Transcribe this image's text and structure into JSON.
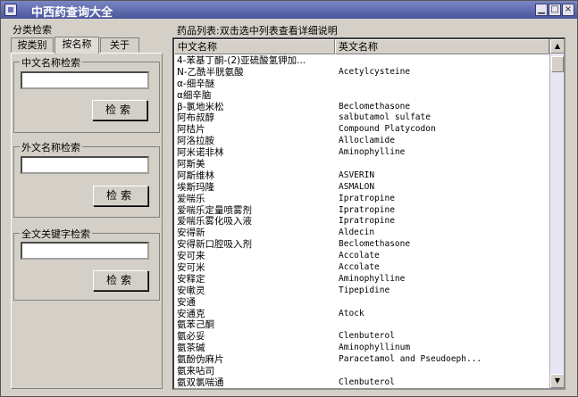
{
  "window": {
    "title": "中西药查询大全"
  },
  "left_panel": {
    "header": "分类检索",
    "tabs": [
      "按类别",
      "按名称",
      "关于"
    ],
    "groups": [
      {
        "label": "中文名称检索",
        "input_value": "",
        "button": "检索"
      },
      {
        "label": "外文名称检索",
        "input_value": "",
        "button": "检索"
      },
      {
        "label": "全文关键字检索",
        "input_value": "",
        "button": "检索"
      }
    ]
  },
  "list": {
    "header": "药品列表:双击选中列表查看详细说明",
    "columns": [
      "中文名称",
      "英文名称"
    ],
    "rows": [
      {
        "cn": "4-苯基丁酮-(2)亚硫酸氢钾加...",
        "en": ""
      },
      {
        "cn": "N-乙酰半胱氨酸",
        "en": "Acetylcysteine"
      },
      {
        "cn": "α-细辛醚",
        "en": ""
      },
      {
        "cn": "α细辛脑",
        "en": ""
      },
      {
        "cn": "β-氯地米松",
        "en": "Beclomethasone"
      },
      {
        "cn": "阿布叔醇",
        "en": "salbutamol sulfate"
      },
      {
        "cn": "阿桔片",
        "en": "Compound Platycodon"
      },
      {
        "cn": "阿洛拉胺",
        "en": "Alloclamide"
      },
      {
        "cn": "阿米诺非林",
        "en": "Aminophylline"
      },
      {
        "cn": "阿斯美",
        "en": ""
      },
      {
        "cn": "阿斯维林",
        "en": "ASVERIN"
      },
      {
        "cn": "埃斯玛隆",
        "en": "ASMALON"
      },
      {
        "cn": "爱喘乐",
        "en": "Ipratropine"
      },
      {
        "cn": "爱喘乐定量喷雾剂",
        "en": "Ipratropine"
      },
      {
        "cn": "爱喘乐雾化吸入液",
        "en": "Ipratropine"
      },
      {
        "cn": "安得新",
        "en": "Aldecin"
      },
      {
        "cn": "安得新口腔吸入剂",
        "en": "Beclomethasone"
      },
      {
        "cn": "安可来",
        "en": "Accolate"
      },
      {
        "cn": "安可米",
        "en": "Accolate"
      },
      {
        "cn": "安释定",
        "en": "Aminophylline"
      },
      {
        "cn": "安嗽灵",
        "en": "Tipepidine"
      },
      {
        "cn": "安通",
        "en": ""
      },
      {
        "cn": "安通克",
        "en": "Atock"
      },
      {
        "cn": "氨苯己酮",
        "en": ""
      },
      {
        "cn": "氨必妥",
        "en": "Clenbuterol"
      },
      {
        "cn": "氨茶碱",
        "en": "Aminophyllinum"
      },
      {
        "cn": "氨酚伪麻片",
        "en": "Paracetamol and Pseudoeph..."
      },
      {
        "cn": "氨来呫司",
        "en": ""
      },
      {
        "cn": "氨双氯喘通",
        "en": "Clenbuterol"
      }
    ]
  },
  "icons": {
    "app": "app-icon",
    "min": "minimize-icon",
    "max": "maximize-icon",
    "close": "close-icon"
  }
}
